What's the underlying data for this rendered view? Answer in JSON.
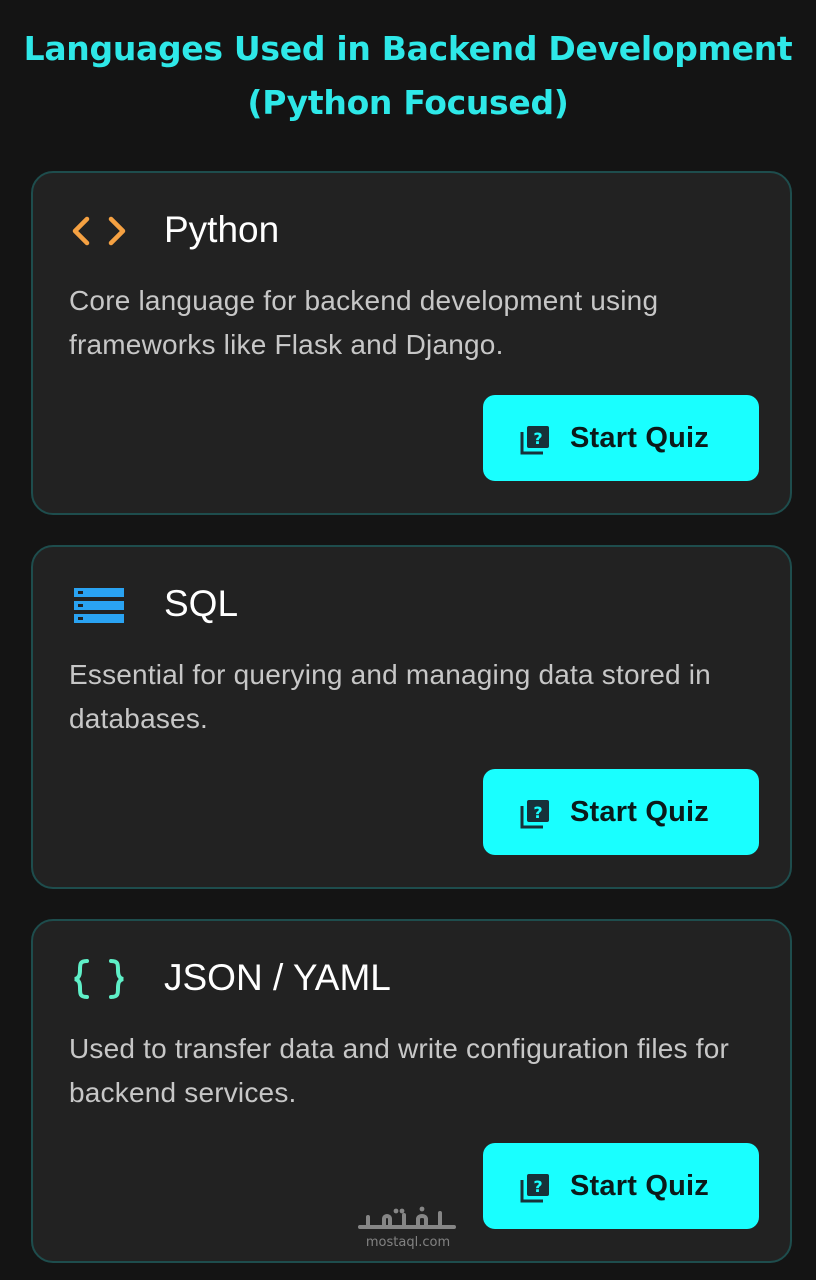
{
  "page": {
    "title": "Languages Used in Backend Development (Python Focused)",
    "background": "#141414",
    "accent": "#19ffff"
  },
  "cards": [
    {
      "title": "Python",
      "icon": "code-brackets-icon",
      "icon_color": "#f5a142",
      "description": "Core language for backend development using frameworks like Flask and Django.",
      "button_label": "Start Quiz",
      "button_icon": "quiz-icon"
    },
    {
      "title": "SQL",
      "icon": "database-icon",
      "icon_color": "#2aa3f2",
      "description": "Essential for querying and managing data stored in databases.",
      "button_label": "Start Quiz",
      "button_icon": "quiz-icon"
    },
    {
      "title": "JSON / YAML",
      "icon": "curly-braces-icon",
      "icon_color": "#5ff0c8",
      "description": "Used to transfer data and write configuration files for backend services.",
      "button_label": "Start Quiz",
      "button_icon": "quiz-icon"
    }
  ],
  "watermark": {
    "logo_text": "مستقل",
    "domain": "mostaql.com"
  }
}
